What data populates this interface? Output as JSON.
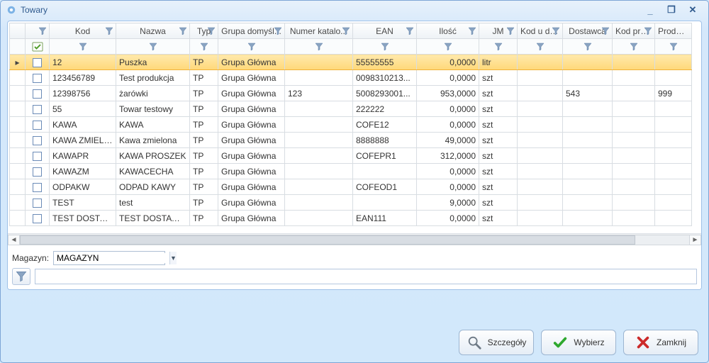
{
  "window": {
    "title": "Towary"
  },
  "columns": [
    {
      "key": "kod",
      "label": "Kod"
    },
    {
      "key": "nazwa",
      "label": "Nazwa"
    },
    {
      "key": "typ",
      "label": "Typ"
    },
    {
      "key": "grupa",
      "label": "Grupa domyśl..."
    },
    {
      "key": "numer",
      "label": "Numer katalo..."
    },
    {
      "key": "ean",
      "label": "EAN"
    },
    {
      "key": "ilosc",
      "label": "Ilość"
    },
    {
      "key": "jm",
      "label": "JM"
    },
    {
      "key": "koddost",
      "label": "Kod u do..."
    },
    {
      "key": "dostawca",
      "label": "Dostawca"
    },
    {
      "key": "kodprod",
      "label": "Kod pro..."
    },
    {
      "key": "producent",
      "label": "Produce..."
    }
  ],
  "rows": [
    {
      "kod": "12",
      "nazwa": "Puszka",
      "typ": "TP",
      "grupa": "Grupa Główna",
      "numer": "",
      "ean": "55555555",
      "ilosc": "0,0000",
      "jm": "litr",
      "koddost": "",
      "dostawca": "",
      "kodprod": "",
      "producent": ""
    },
    {
      "kod": "123456789",
      "nazwa": "Test produkcja",
      "typ": "TP",
      "grupa": "Grupa Główna",
      "numer": "",
      "ean": "0098310213...",
      "ilosc": "0,0000",
      "jm": "szt",
      "koddost": "",
      "dostawca": "",
      "kodprod": "",
      "producent": ""
    },
    {
      "kod": "12398756",
      "nazwa": "żarówki",
      "typ": "TP",
      "grupa": "Grupa Główna",
      "numer": "123",
      "ean": "5008293001...",
      "ilosc": "953,0000",
      "jm": "szt",
      "koddost": "",
      "dostawca": "543",
      "kodprod": "",
      "producent": "999"
    },
    {
      "kod": "55",
      "nazwa": "Towar testowy",
      "typ": "TP",
      "grupa": "Grupa Główna",
      "numer": "",
      "ean": "222222",
      "ilosc": "0,0000",
      "jm": "szt",
      "koddost": "",
      "dostawca": "",
      "kodprod": "",
      "producent": ""
    },
    {
      "kod": "KAWA",
      "nazwa": "KAWA",
      "typ": "TP",
      "grupa": "Grupa Główna",
      "numer": "",
      "ean": "COFE12",
      "ilosc": "0,0000",
      "jm": "szt",
      "koddost": "",
      "dostawca": "",
      "kodprod": "",
      "producent": ""
    },
    {
      "kod": "KAWA  ZMIELO...",
      "nazwa": "Kawa zmielona",
      "typ": "TP",
      "grupa": "Grupa Główna",
      "numer": "",
      "ean": "8888888",
      "ilosc": "49,0000",
      "jm": "szt",
      "koddost": "",
      "dostawca": "",
      "kodprod": "",
      "producent": ""
    },
    {
      "kod": "KAWAPR",
      "nazwa": "KAWA PROSZEK",
      "typ": "TP",
      "grupa": "Grupa Główna",
      "numer": "",
      "ean": "COFEPR1",
      "ilosc": "312,0000",
      "jm": "szt",
      "koddost": "",
      "dostawca": "",
      "kodprod": "",
      "producent": ""
    },
    {
      "kod": "KAWAZM",
      "nazwa": "KAWACECHA",
      "typ": "TP",
      "grupa": "Grupa Główna",
      "numer": "",
      "ean": "",
      "ilosc": "0,0000",
      "jm": "szt",
      "koddost": "",
      "dostawca": "",
      "kodprod": "",
      "producent": ""
    },
    {
      "kod": "ODPAKW",
      "nazwa": "ODPAD KAWY",
      "typ": "TP",
      "grupa": "Grupa Główna",
      "numer": "",
      "ean": "COFEOD1",
      "ilosc": "0,0000",
      "jm": "szt",
      "koddost": "",
      "dostawca": "",
      "kodprod": "",
      "producent": ""
    },
    {
      "kod": "TEST",
      "nazwa": "test",
      "typ": "TP",
      "grupa": "Grupa Główna",
      "numer": "",
      "ean": "",
      "ilosc": "9,0000",
      "jm": "szt",
      "koddost": "",
      "dostawca": "",
      "kodprod": "",
      "producent": ""
    },
    {
      "kod": "TEST DOSTAWCY",
      "nazwa": "TEST DOSTAWC...",
      "typ": "TP",
      "grupa": "Grupa Główna",
      "numer": "",
      "ean": "EAN111",
      "ilosc": "0,0000",
      "jm": "szt",
      "koddost": "",
      "dostawca": "",
      "kodprod": "",
      "producent": ""
    }
  ],
  "magazyn": {
    "label": "Magazyn:",
    "value": "MAGAZYN"
  },
  "buttons": {
    "details": "Szczegóły",
    "select": "Wybierz",
    "close": "Zamknij"
  }
}
